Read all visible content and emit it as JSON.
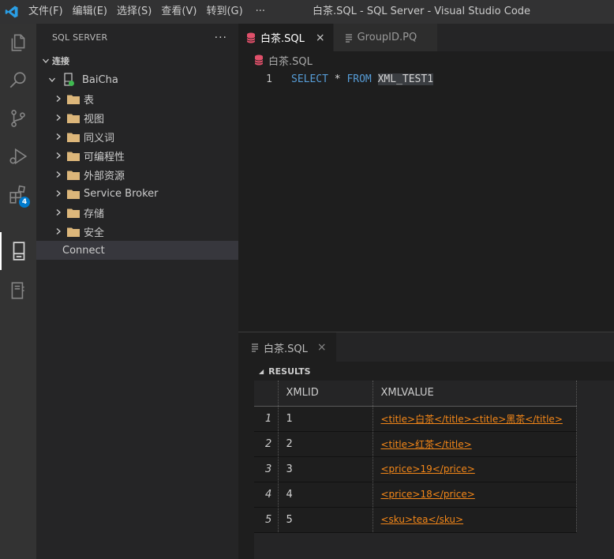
{
  "titlebar": {
    "menus": [
      "文件(F)",
      "编辑(E)",
      "选择(S)",
      "查看(V)",
      "转到(G)"
    ],
    "more": "···",
    "title": "白茶.SQL - SQL Server - Visual Studio Code"
  },
  "activity": {
    "extensions_badge": "4"
  },
  "sidebar": {
    "title": "SQL SERVER",
    "more": "···",
    "section": "连接",
    "server": "BaiCha",
    "folders": [
      "表",
      "视图",
      "同义词",
      "可编程性",
      "外部资源",
      "Service Broker",
      "存储",
      "安全"
    ],
    "connect": "Connect"
  },
  "editor": {
    "tabs": [
      {
        "label": "白茶.SQL",
        "close": "×"
      },
      {
        "label": "GroupID.PQ"
      }
    ],
    "breadcrumb": "白茶.SQL",
    "lines": [
      {
        "number": "1",
        "kw1": "SELECT",
        "op": "*",
        "kw2": "FROM",
        "table": "XML_TEST1"
      }
    ]
  },
  "results": {
    "tab_label": "白茶.SQL",
    "tab_close": "×",
    "header": "RESULTS",
    "columns": [
      "XMLID",
      "XMLVALUE"
    ],
    "rows": [
      {
        "num": "1",
        "id": "1",
        "value": "<title>白茶</title><title>黑茶</title>"
      },
      {
        "num": "2",
        "id": "2",
        "value": "<title>红茶</title>"
      },
      {
        "num": "3",
        "id": "3",
        "value": "<price>19</price>"
      },
      {
        "num": "4",
        "id": "4",
        "value": "<price>18</price>"
      },
      {
        "num": "5",
        "id": "5",
        "value": "<sku>tea</sku>"
      }
    ]
  },
  "colors": {
    "accent": "#007acc",
    "keyword": "#569cd6",
    "xml_link": "#f48718",
    "db_icon": "#e0506a",
    "folder": "#dcb67a",
    "status_green": "#3fb950"
  }
}
